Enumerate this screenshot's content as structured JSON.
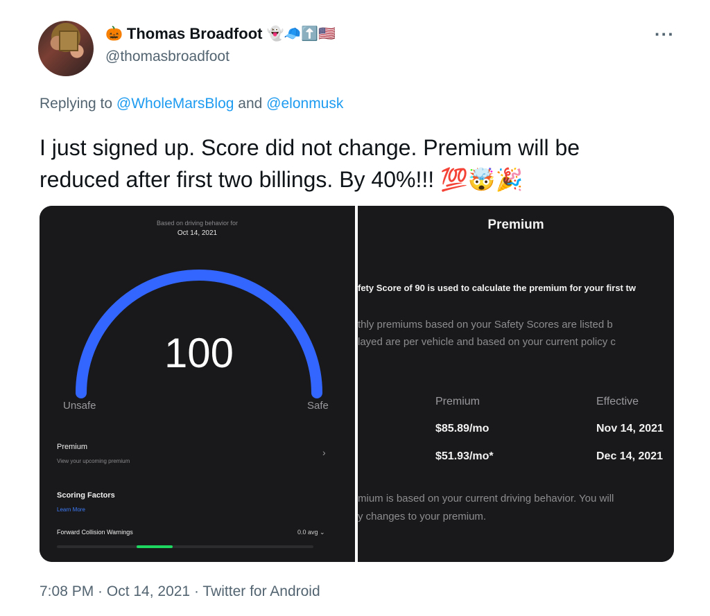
{
  "tweet": {
    "author_name": "Thomas Broadfoot",
    "name_prefix_emoji": "🎃",
    "name_suffix_emojis": "👻🧢⬆️🇺🇸",
    "handle": "@thomasbroadfoot",
    "more_label": "···",
    "reply_prefix": "Replying to ",
    "reply_mention_1": "@WholeMarsBlog",
    "reply_and": " and ",
    "reply_mention_2": "@elonmusk",
    "text_line_1": "I just signed up. Score did not change. Premium will be",
    "text_line_2": "reduced after first two billings. By 40%!!! 💯🤯🎉",
    "timestamp": "7:08 PM · Oct 14, 2021 · Twitter for Android"
  },
  "left_screen": {
    "based_on": "Based on driving behavior for",
    "date": "Oct 14, 2021",
    "score": "100",
    "gauge_fraction": 1.0,
    "unsafe_label": "Unsafe",
    "safe_label": "Safe",
    "premium_label": "Premium",
    "premium_sub": "View your upcoming premium",
    "chevron": "›",
    "scoring_label": "Scoring Factors",
    "learn_more": "Learn More",
    "factor_label": "Forward Collision Warnings",
    "factor_value": "0.0 avg",
    "factor_chevron": "⌄",
    "colors": {
      "gauge": "#3366ff",
      "bar": "#1ed760"
    }
  },
  "right_screen": {
    "title": "Premium",
    "line_1": "fety Score of 90 is used to calculate the premium for your first tw",
    "line_2": "thly premiums based on your Safety Scores are listed b",
    "line_3": "layed are per vehicle and based on your current policy c",
    "col_premium": "Premium",
    "col_effective": "Effective",
    "row_1_premium": "$85.89/mo",
    "row_1_effective": "Nov 14, 2021",
    "row_2_premium": "$51.93/mo*",
    "row_2_effective": "Dec 14, 2021",
    "line_4": "mium is based on your current driving behavior. You will",
    "line_5": "y changes to your premium."
  }
}
